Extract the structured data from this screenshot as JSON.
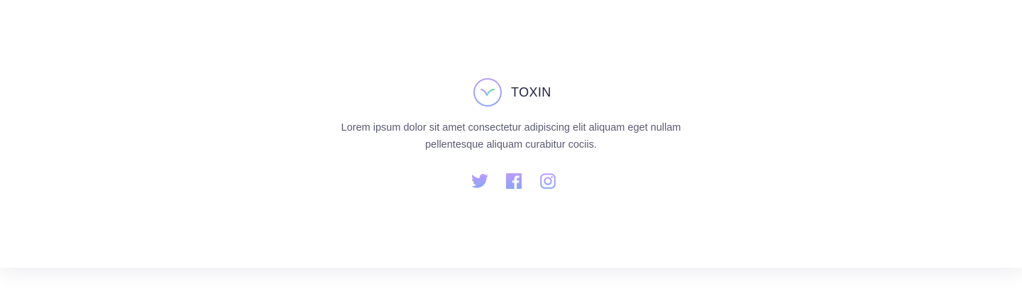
{
  "footer": {
    "brand": {
      "name": "TOXIN",
      "logo_icon": "toxin-logo-icon"
    },
    "tagline": "Lorem ipsum dolor sit amet consectetur adipiscing elit aliquam eget nullam pellentesque aliquam curabitur cociis.",
    "social_links": [
      {
        "icon": "twitter-icon"
      },
      {
        "icon": "facebook-icon"
      },
      {
        "icon": "instagram-icon"
      }
    ]
  },
  "colors": {
    "text_dark": "#1f2041",
    "accent_purple": "#bc9cff",
    "accent_purple_dark": "#8ba4f9",
    "accent_green": "#6fcf97"
  }
}
